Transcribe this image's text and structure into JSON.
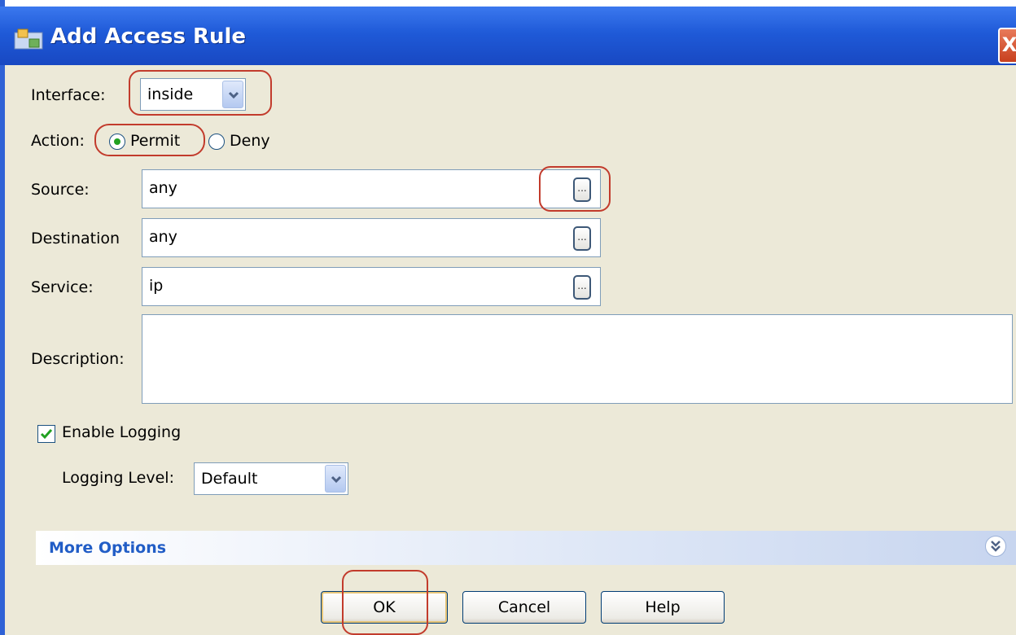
{
  "window": {
    "title": "Add Access Rule",
    "close_glyph": "X"
  },
  "form": {
    "interface": {
      "label": "Interface:",
      "value": "inside"
    },
    "action": {
      "label": "Action:",
      "options": [
        "Permit",
        "Deny"
      ],
      "selected": "Permit"
    },
    "source": {
      "label": "Source:",
      "value": "any"
    },
    "destination": {
      "label": "Destination",
      "value": "any"
    },
    "service": {
      "label": "Service:",
      "value": "ip"
    },
    "description": {
      "label": "Description:",
      "value": ""
    },
    "enable_logging": {
      "label": "Enable Logging",
      "checked": true
    },
    "logging_level": {
      "label": "Logging Level:",
      "value": "Default"
    },
    "browse_glyph": "..."
  },
  "more_options": {
    "label": "More Options"
  },
  "buttons": {
    "ok": "OK",
    "cancel": "Cancel",
    "help": "Help"
  },
  "colors": {
    "titlebar": "#1f5ad8",
    "dialog_bg": "#ece9d8",
    "highlight": "#c23b2c",
    "link_blue": "#215dc6"
  },
  "icons": [
    "app-icon",
    "close-icon",
    "chevron-down-icon",
    "radio-icon",
    "checkmark-icon",
    "expand-icon"
  ]
}
